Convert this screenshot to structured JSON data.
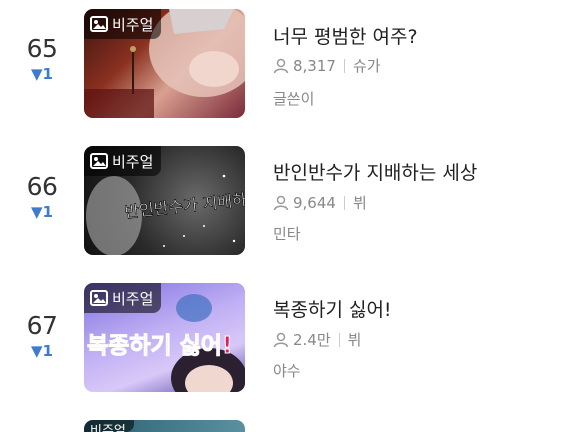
{
  "items": [
    {
      "rank": "65",
      "change": "▼1",
      "badge": "비주얼",
      "title": "너무 평범한 여주?",
      "views": "8,317",
      "genre": "슈가",
      "author": "글쓴이",
      "colors": {
        "bg1": "#4a1a14",
        "bg2": "#c05a3a",
        "bg3": "#e8b4a0"
      }
    },
    {
      "rank": "66",
      "change": "▼1",
      "badge": "비주얼",
      "title": "반인반수가 지배하는 세상",
      "views": "9,644",
      "genre": "뷔",
      "author": "민타",
      "thumb_text": "반인반수가 지배하는 세상",
      "colors": {
        "bg1": "#1a1a1a",
        "bg2": "#3a3a3a",
        "bg3": "#6a6a6a"
      }
    },
    {
      "rank": "67",
      "change": "▼1",
      "badge": "비주얼",
      "title": "복종하기 싫어!",
      "views": "2.4만",
      "genre": "뷔",
      "author": "야수",
      "thumb_text": "복종하기 싫어!",
      "colors": {
        "bg1": "#7a6ad8",
        "bg2": "#b0a0f0",
        "bg3": "#e04060"
      }
    }
  ],
  "peek": {
    "badge": "비주얼"
  }
}
